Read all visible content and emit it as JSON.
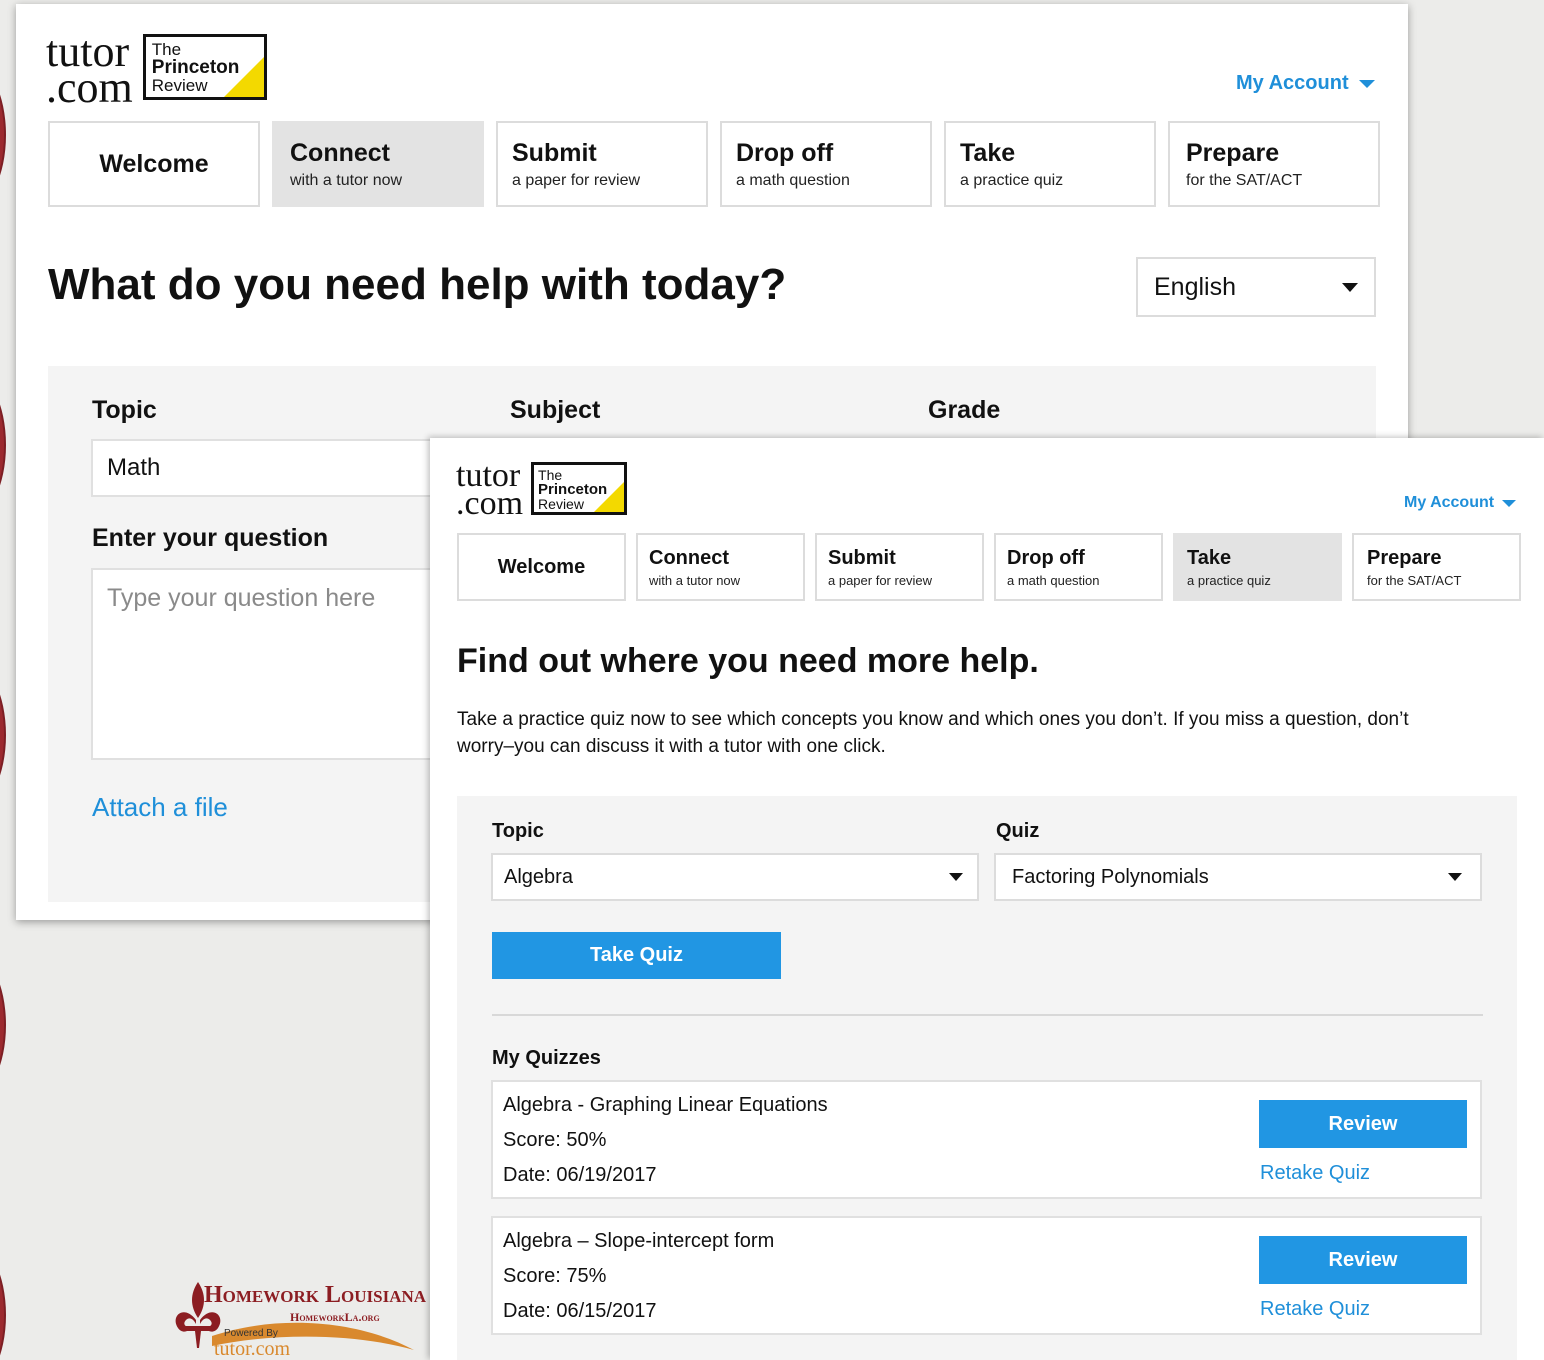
{
  "logo": {
    "word_top": "tutor",
    "word_bottom": ".com",
    "box_line1": "The",
    "box_line2": "Princeton",
    "box_line3": "Review",
    "accent": "#f3d900"
  },
  "back": {
    "account": "My Account",
    "nav": [
      {
        "title": "Welcome",
        "sub": ""
      },
      {
        "title": "Connect",
        "sub": "with a tutor now"
      },
      {
        "title": "Submit",
        "sub": "a paper for review"
      },
      {
        "title": "Drop off",
        "sub": "a math question"
      },
      {
        "title": "Take",
        "sub": "a practice quiz"
      },
      {
        "title": "Prepare",
        "sub": "for the SAT/ACT"
      }
    ],
    "active_tab": "Connect",
    "heading": "What do you need help with today?",
    "language": "English",
    "form": {
      "topic_label": "Topic",
      "subject_label": "Subject",
      "grade_label": "Grade",
      "topic_value": "Math",
      "question_label": "Enter your question",
      "question_placeholder": "Type your question here",
      "attach": "Attach a file"
    }
  },
  "front": {
    "account": "My Account",
    "nav": [
      {
        "title": "Welcome",
        "sub": ""
      },
      {
        "title": "Connect",
        "sub": "with a tutor now"
      },
      {
        "title": "Submit",
        "sub": "a paper for review"
      },
      {
        "title": "Drop off",
        "sub": "a math question"
      },
      {
        "title": "Take",
        "sub": "a practice quiz"
      },
      {
        "title": "Prepare",
        "sub": "for the SAT/ACT"
      }
    ],
    "active_tab": "Take",
    "heading": "Find out where you need more help.",
    "description_line1": "Take a practice quiz now to see which concepts you know and which ones you don’t. If you miss a question, don’t",
    "description_line2": "worry–you can discuss it with a tutor with one click.",
    "topic_label": "Topic",
    "quiz_label": "Quiz",
    "topic_value": "Algebra",
    "quiz_value": "Factoring Polynomials",
    "take_quiz": "Take Quiz",
    "my_quizzes": "My Quizzes",
    "quizzes": [
      {
        "name": "Algebra - Graphing Linear Equations",
        "score": "Score: 50%",
        "date": "Date: 06/19/2017",
        "review": "Review",
        "retake": "Retake Quiz"
      },
      {
        "name": "Algebra – Slope-intercept form",
        "score": "Score: 75%",
        "date": "Date: 06/15/2017",
        "review": "Review",
        "retake": "Retake Quiz"
      }
    ]
  },
  "homework_logo": {
    "title": "Homework Louisiana",
    "url": "HomeworkLa.org",
    "powered": "Powered By",
    "brand": "tutor.com"
  },
  "colors": {
    "link_blue": "#1f8fd9",
    "button_blue": "#2196e3",
    "active_tab": "#e3e3e3",
    "maroon": "#9c2a2f"
  }
}
